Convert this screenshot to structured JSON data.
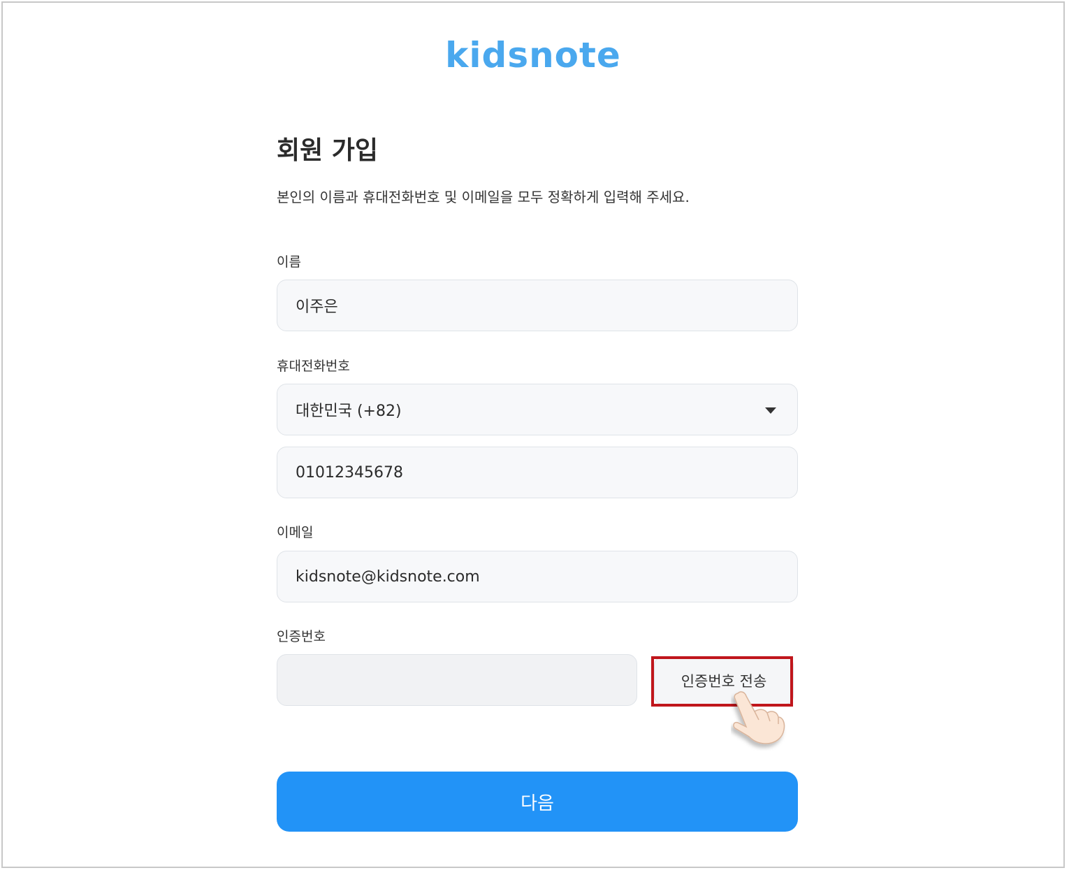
{
  "colors": {
    "brand": "#4aa8ee",
    "primary_button": "#2293f7",
    "highlight_border": "#c0161c"
  },
  "header": {
    "logo_text": "kidsnote"
  },
  "page": {
    "title": "회원 가입",
    "subtitle": "본인의 이름과 휴대전화번호 및 이메일을 모두 정확하게 입력해 주세요."
  },
  "form": {
    "name": {
      "label": "이름",
      "value": "이주은"
    },
    "phone": {
      "label": "휴대전화번호",
      "country_selected": "대한민국 (+82)",
      "number_value": "01012345678"
    },
    "email": {
      "label": "이메일",
      "value": "kidsnote@kidsnote.com"
    },
    "verification": {
      "label": "인증번호",
      "value": "",
      "send_button_label": "인증번호 전송"
    },
    "next_button_label": "다음"
  },
  "icons": {
    "dropdown": "chevron-down-icon",
    "pointer": "pointing-hand-icon"
  }
}
